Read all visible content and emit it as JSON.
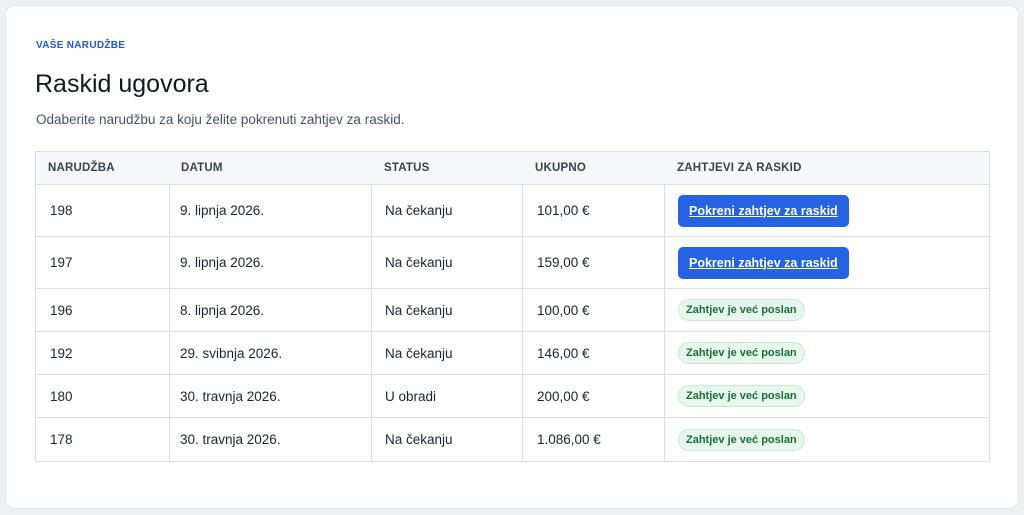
{
  "page": {
    "eyebrow": "VAŠE NARUDŽBE",
    "title": "Raskid ugovora",
    "subtitle": "Odaberite narudžbu za koju želite pokrenuti zahtjev za raskid."
  },
  "table": {
    "headers": [
      "NARUDŽBA",
      "DATUM",
      "STATUS",
      "UKUPNO",
      "ZAHTJEVI ZA RASKID"
    ],
    "rows": [
      {
        "order": "198",
        "date": "9. lipnja 2026.",
        "status": "Na čekanju",
        "total": "101,00 €",
        "action": "Pokreni zahtjev za raskid",
        "action_type": "button"
      },
      {
        "order": "197",
        "date": "9. lipnja 2026.",
        "status": "Na čekanju",
        "total": "159,00 €",
        "action": "Pokreni zahtjev za raskid",
        "action_type": "button"
      },
      {
        "order": "196",
        "date": "8. lipnja 2026.",
        "status": "Na čekanju",
        "total": "100,00 €",
        "action": "Zahtjev je već poslan",
        "action_type": "badge"
      },
      {
        "order": "192",
        "date": "29. svibnja 2026.",
        "status": "Na čekanju",
        "total": "146,00 €",
        "action": "Zahtjev je već poslan",
        "action_type": "badge"
      },
      {
        "order": "180",
        "date": "30. travnja 2026.",
        "status": "U obradi",
        "total": "200,00 €",
        "action": "Zahtjev je već poslan",
        "action_type": "badge"
      },
      {
        "order": "178",
        "date": "30. travnja 2026.",
        "status": "Na čekanju",
        "total": "1.086,00 €",
        "action": "Zahtjev je već poslan",
        "action_type": "badge"
      }
    ]
  },
  "colors": {
    "accent": "#2563e3",
    "eyebrow": "#2557d6",
    "badge_bg": "#e8f7ec",
    "badge_text": "#17703a"
  }
}
